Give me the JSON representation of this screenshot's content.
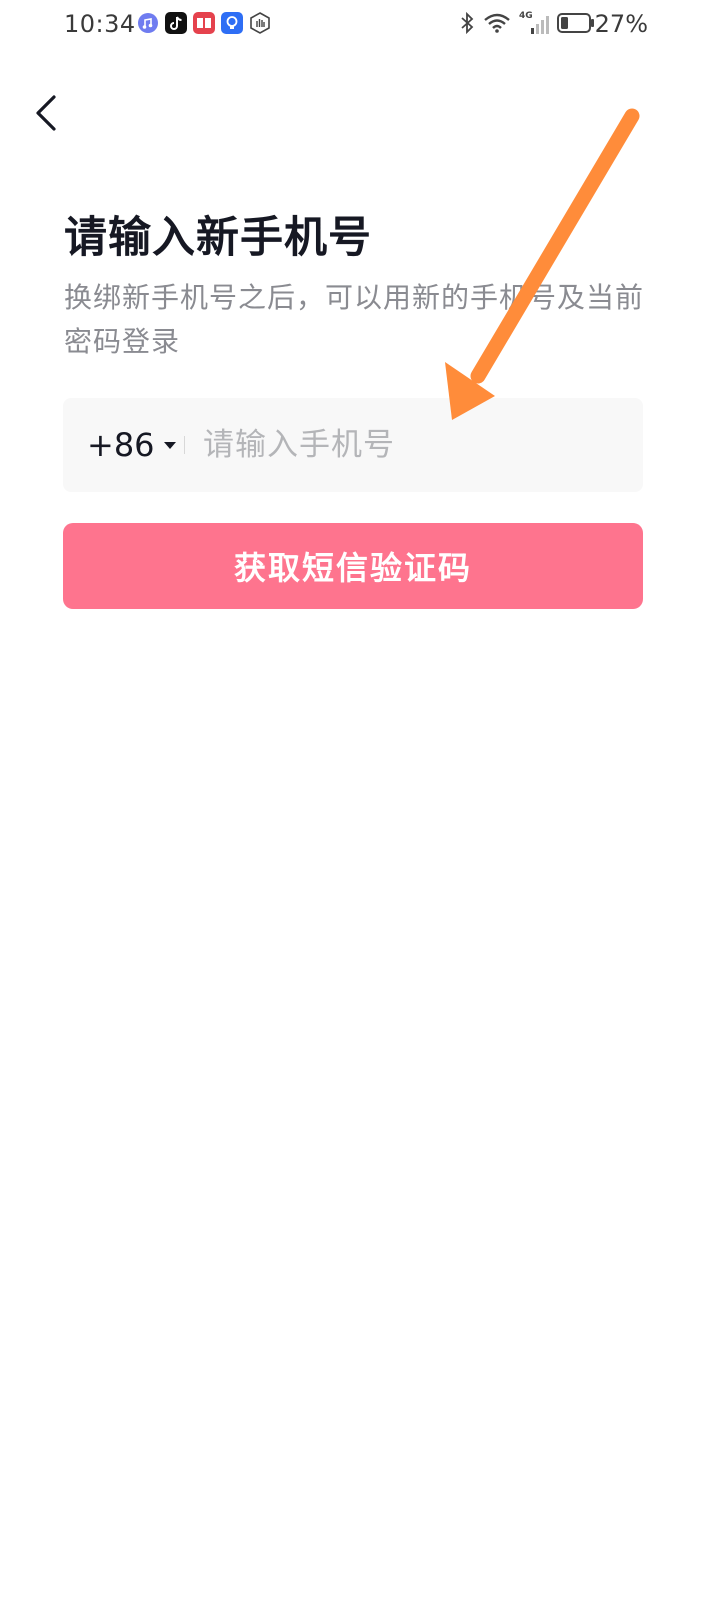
{
  "status_bar": {
    "time": "10:34",
    "battery_percent": "27%",
    "network_label": "4G"
  },
  "page": {
    "title": "请输入新手机号",
    "subtitle": "换绑新手机号之后，可以用新的手机号及当前密码登录"
  },
  "phone_input": {
    "country_code": "+86",
    "placeholder": "请输入手机号",
    "value": ""
  },
  "sms_button": {
    "label": "获取短信验证码"
  },
  "colors": {
    "accent": "#fe748e",
    "annotation_arrow": "#ff8c3a"
  },
  "icons": {
    "back": "chevron-left-icon",
    "dropdown": "caret-down-icon"
  }
}
